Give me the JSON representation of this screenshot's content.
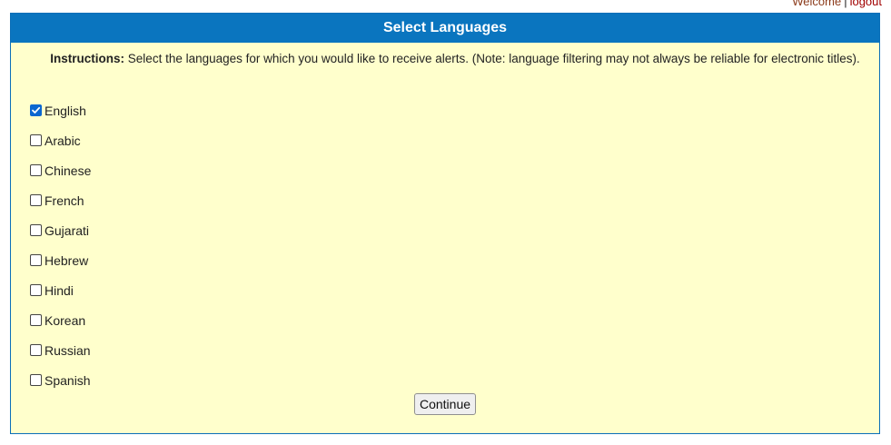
{
  "topbar": {
    "welcome": "Welcome",
    "separator": "|",
    "logout": "logout"
  },
  "panel": {
    "title": "Select Languages",
    "instructions_label": "Instructions:",
    "instructions_text": "Select the languages for which you would like to receive alerts. (Note: language filtering may not always be reliable for electronic titles)."
  },
  "languages": [
    {
      "label": "English",
      "checked": true
    },
    {
      "label": "Arabic",
      "checked": false
    },
    {
      "label": "Chinese",
      "checked": false
    },
    {
      "label": "French",
      "checked": false
    },
    {
      "label": "Gujarati",
      "checked": false
    },
    {
      "label": "Hebrew",
      "checked": false
    },
    {
      "label": "Hindi",
      "checked": false
    },
    {
      "label": "Korean",
      "checked": false
    },
    {
      "label": "Russian",
      "checked": false
    },
    {
      "label": "Spanish",
      "checked": false
    }
  ],
  "actions": {
    "continue_label": "Continue"
  },
  "colors": {
    "header_bg": "#0a75bf",
    "panel_bg": "#ffffcc",
    "checkbox_checked": "#0b67d0"
  }
}
